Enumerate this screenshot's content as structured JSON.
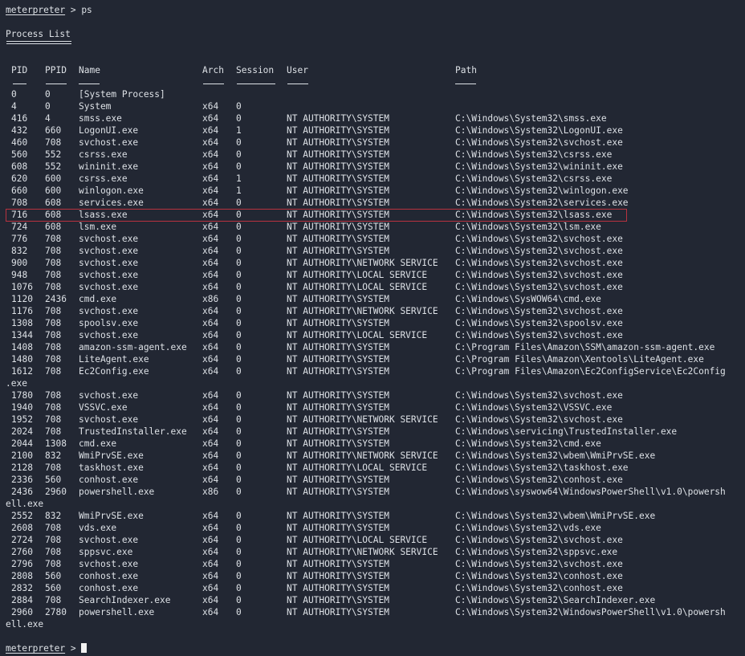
{
  "terminal": {
    "prompt": "meterpreter",
    "prompt_sep": " > ",
    "command": "ps",
    "title": "Process List",
    "columns": {
      "pid": "PID",
      "ppid": "PPID",
      "name": "Name",
      "arch": "Arch",
      "session": "Session",
      "user": "User",
      "path": "Path"
    },
    "highlight_color": "#b8323f",
    "highlighted_pid": "716",
    "processes": [
      {
        "pid": "0",
        "ppid": "0",
        "name": "[System Process]",
        "arch": "",
        "session": "",
        "user": "",
        "path": "",
        "wrap": ""
      },
      {
        "pid": "4",
        "ppid": "0",
        "name": "System",
        "arch": "x64",
        "session": "0",
        "user": "",
        "path": "",
        "wrap": ""
      },
      {
        "pid": "416",
        "ppid": "4",
        "name": "smss.exe",
        "arch": "x64",
        "session": "0",
        "user": "NT AUTHORITY\\SYSTEM",
        "path": "C:\\Windows\\System32\\smss.exe",
        "wrap": ""
      },
      {
        "pid": "432",
        "ppid": "660",
        "name": "LogonUI.exe",
        "arch": "x64",
        "session": "1",
        "user": "NT AUTHORITY\\SYSTEM",
        "path": "C:\\Windows\\System32\\LogonUI.exe",
        "wrap": ""
      },
      {
        "pid": "460",
        "ppid": "708",
        "name": "svchost.exe",
        "arch": "x64",
        "session": "0",
        "user": "NT AUTHORITY\\SYSTEM",
        "path": "C:\\Windows\\System32\\svchost.exe",
        "wrap": ""
      },
      {
        "pid": "560",
        "ppid": "552",
        "name": "csrss.exe",
        "arch": "x64",
        "session": "0",
        "user": "NT AUTHORITY\\SYSTEM",
        "path": "C:\\Windows\\System32\\csrss.exe",
        "wrap": ""
      },
      {
        "pid": "608",
        "ppid": "552",
        "name": "wininit.exe",
        "arch": "x64",
        "session": "0",
        "user": "NT AUTHORITY\\SYSTEM",
        "path": "C:\\Windows\\System32\\wininit.exe",
        "wrap": ""
      },
      {
        "pid": "620",
        "ppid": "600",
        "name": "csrss.exe",
        "arch": "x64",
        "session": "1",
        "user": "NT AUTHORITY\\SYSTEM",
        "path": "C:\\Windows\\System32\\csrss.exe",
        "wrap": ""
      },
      {
        "pid": "660",
        "ppid": "600",
        "name": "winlogon.exe",
        "arch": "x64",
        "session": "1",
        "user": "NT AUTHORITY\\SYSTEM",
        "path": "C:\\Windows\\System32\\winlogon.exe",
        "wrap": ""
      },
      {
        "pid": "708",
        "ppid": "608",
        "name": "services.exe",
        "arch": "x64",
        "session": "0",
        "user": "NT AUTHORITY\\SYSTEM",
        "path": "C:\\Windows\\System32\\services.exe",
        "wrap": ""
      },
      {
        "pid": "716",
        "ppid": "608",
        "name": "lsass.exe",
        "arch": "x64",
        "session": "0",
        "user": "NT AUTHORITY\\SYSTEM",
        "path": "C:\\Windows\\System32\\lsass.exe",
        "wrap": ""
      },
      {
        "pid": "724",
        "ppid": "608",
        "name": "lsm.exe",
        "arch": "x64",
        "session": "0",
        "user": "NT AUTHORITY\\SYSTEM",
        "path": "C:\\Windows\\System32\\lsm.exe",
        "wrap": ""
      },
      {
        "pid": "776",
        "ppid": "708",
        "name": "svchost.exe",
        "arch": "x64",
        "session": "0",
        "user": "NT AUTHORITY\\SYSTEM",
        "path": "C:\\Windows\\System32\\svchost.exe",
        "wrap": ""
      },
      {
        "pid": "832",
        "ppid": "708",
        "name": "svchost.exe",
        "arch": "x64",
        "session": "0",
        "user": "NT AUTHORITY\\SYSTEM",
        "path": "C:\\Windows\\System32\\svchost.exe",
        "wrap": ""
      },
      {
        "pid": "900",
        "ppid": "708",
        "name": "svchost.exe",
        "arch": "x64",
        "session": "0",
        "user": "NT AUTHORITY\\NETWORK SERVICE",
        "path": "C:\\Windows\\System32\\svchost.exe",
        "wrap": ""
      },
      {
        "pid": "948",
        "ppid": "708",
        "name": "svchost.exe",
        "arch": "x64",
        "session": "0",
        "user": "NT AUTHORITY\\LOCAL SERVICE",
        "path": "C:\\Windows\\System32\\svchost.exe",
        "wrap": ""
      },
      {
        "pid": "1076",
        "ppid": "708",
        "name": "svchost.exe",
        "arch": "x64",
        "session": "0",
        "user": "NT AUTHORITY\\LOCAL SERVICE",
        "path": "C:\\Windows\\System32\\svchost.exe",
        "wrap": ""
      },
      {
        "pid": "1120",
        "ppid": "2436",
        "name": "cmd.exe",
        "arch": "x86",
        "session": "0",
        "user": "NT AUTHORITY\\SYSTEM",
        "path": "C:\\Windows\\SysWOW64\\cmd.exe",
        "wrap": ""
      },
      {
        "pid": "1176",
        "ppid": "708",
        "name": "svchost.exe",
        "arch": "x64",
        "session": "0",
        "user": "NT AUTHORITY\\NETWORK SERVICE",
        "path": "C:\\Windows\\System32\\svchost.exe",
        "wrap": ""
      },
      {
        "pid": "1308",
        "ppid": "708",
        "name": "spoolsv.exe",
        "arch": "x64",
        "session": "0",
        "user": "NT AUTHORITY\\SYSTEM",
        "path": "C:\\Windows\\System32\\spoolsv.exe",
        "wrap": ""
      },
      {
        "pid": "1344",
        "ppid": "708",
        "name": "svchost.exe",
        "arch": "x64",
        "session": "0",
        "user": "NT AUTHORITY\\LOCAL SERVICE",
        "path": "C:\\Windows\\System32\\svchost.exe",
        "wrap": ""
      },
      {
        "pid": "1408",
        "ppid": "708",
        "name": "amazon-ssm-agent.exe",
        "arch": "x64",
        "session": "0",
        "user": "NT AUTHORITY\\SYSTEM",
        "path": "C:\\Program Files\\Amazon\\SSM\\amazon-ssm-agent.exe",
        "wrap": ""
      },
      {
        "pid": "1480",
        "ppid": "708",
        "name": "LiteAgent.exe",
        "arch": "x64",
        "session": "0",
        "user": "NT AUTHORITY\\SYSTEM",
        "path": "C:\\Program Files\\Amazon\\Xentools\\LiteAgent.exe",
        "wrap": ""
      },
      {
        "pid": "1612",
        "ppid": "708",
        "name": "Ec2Config.exe",
        "arch": "x64",
        "session": "0",
        "user": "NT AUTHORITY\\SYSTEM",
        "path": "C:\\Program Files\\Amazon\\Ec2ConfigService\\Ec2Config",
        "wrap": ".exe"
      },
      {
        "pid": "1780",
        "ppid": "708",
        "name": "svchost.exe",
        "arch": "x64",
        "session": "0",
        "user": "NT AUTHORITY\\SYSTEM",
        "path": "C:\\Windows\\System32\\svchost.exe",
        "wrap": ""
      },
      {
        "pid": "1940",
        "ppid": "708",
        "name": "VSSVC.exe",
        "arch": "x64",
        "session": "0",
        "user": "NT AUTHORITY\\SYSTEM",
        "path": "C:\\Windows\\System32\\VSSVC.exe",
        "wrap": ""
      },
      {
        "pid": "1952",
        "ppid": "708",
        "name": "svchost.exe",
        "arch": "x64",
        "session": "0",
        "user": "NT AUTHORITY\\NETWORK SERVICE",
        "path": "C:\\Windows\\System32\\svchost.exe",
        "wrap": ""
      },
      {
        "pid": "2024",
        "ppid": "708",
        "name": "TrustedInstaller.exe",
        "arch": "x64",
        "session": "0",
        "user": "NT AUTHORITY\\SYSTEM",
        "path": "C:\\Windows\\servicing\\TrustedInstaller.exe",
        "wrap": ""
      },
      {
        "pid": "2044",
        "ppid": "1308",
        "name": "cmd.exe",
        "arch": "x64",
        "session": "0",
        "user": "NT AUTHORITY\\SYSTEM",
        "path": "C:\\Windows\\System32\\cmd.exe",
        "wrap": ""
      },
      {
        "pid": "2100",
        "ppid": "832",
        "name": "WmiPrvSE.exe",
        "arch": "x64",
        "session": "0",
        "user": "NT AUTHORITY\\NETWORK SERVICE",
        "path": "C:\\Windows\\System32\\wbem\\WmiPrvSE.exe",
        "wrap": ""
      },
      {
        "pid": "2128",
        "ppid": "708",
        "name": "taskhost.exe",
        "arch": "x64",
        "session": "0",
        "user": "NT AUTHORITY\\LOCAL SERVICE",
        "path": "C:\\Windows\\System32\\taskhost.exe",
        "wrap": ""
      },
      {
        "pid": "2336",
        "ppid": "560",
        "name": "conhost.exe",
        "arch": "x64",
        "session": "0",
        "user": "NT AUTHORITY\\SYSTEM",
        "path": "C:\\Windows\\System32\\conhost.exe",
        "wrap": ""
      },
      {
        "pid": "2436",
        "ppid": "2960",
        "name": "powershell.exe",
        "arch": "x86",
        "session": "0",
        "user": "NT AUTHORITY\\SYSTEM",
        "path": "C:\\Windows\\syswow64\\WindowsPowerShell\\v1.0\\powersh",
        "wrap": "ell.exe"
      },
      {
        "pid": "2552",
        "ppid": "832",
        "name": "WmiPrvSE.exe",
        "arch": "x64",
        "session": "0",
        "user": "NT AUTHORITY\\SYSTEM",
        "path": "C:\\Windows\\System32\\wbem\\WmiPrvSE.exe",
        "wrap": ""
      },
      {
        "pid": "2608",
        "ppid": "708",
        "name": "vds.exe",
        "arch": "x64",
        "session": "0",
        "user": "NT AUTHORITY\\SYSTEM",
        "path": "C:\\Windows\\System32\\vds.exe",
        "wrap": ""
      },
      {
        "pid": "2724",
        "ppid": "708",
        "name": "svchost.exe",
        "arch": "x64",
        "session": "0",
        "user": "NT AUTHORITY\\LOCAL SERVICE",
        "path": "C:\\Windows\\System32\\svchost.exe",
        "wrap": ""
      },
      {
        "pid": "2760",
        "ppid": "708",
        "name": "sppsvc.exe",
        "arch": "x64",
        "session": "0",
        "user": "NT AUTHORITY\\NETWORK SERVICE",
        "path": "C:\\Windows\\System32\\sppsvc.exe",
        "wrap": ""
      },
      {
        "pid": "2796",
        "ppid": "708",
        "name": "svchost.exe",
        "arch": "x64",
        "session": "0",
        "user": "NT AUTHORITY\\SYSTEM",
        "path": "C:\\Windows\\System32\\svchost.exe",
        "wrap": ""
      },
      {
        "pid": "2808",
        "ppid": "560",
        "name": "conhost.exe",
        "arch": "x64",
        "session": "0",
        "user": "NT AUTHORITY\\SYSTEM",
        "path": "C:\\Windows\\System32\\conhost.exe",
        "wrap": ""
      },
      {
        "pid": "2832",
        "ppid": "560",
        "name": "conhost.exe",
        "arch": "x64",
        "session": "0",
        "user": "NT AUTHORITY\\SYSTEM",
        "path": "C:\\Windows\\System32\\conhost.exe",
        "wrap": ""
      },
      {
        "pid": "2884",
        "ppid": "708",
        "name": "SearchIndexer.exe",
        "arch": "x64",
        "session": "0",
        "user": "NT AUTHORITY\\SYSTEM",
        "path": "C:\\Windows\\System32\\SearchIndexer.exe",
        "wrap": ""
      },
      {
        "pid": "2960",
        "ppid": "2780",
        "name": "powershell.exe",
        "arch": "x64",
        "session": "0",
        "user": "NT AUTHORITY\\SYSTEM",
        "path": "C:\\Windows\\System32\\WindowsPowerShell\\v1.0\\powersh",
        "wrap": "ell.exe"
      }
    ]
  }
}
